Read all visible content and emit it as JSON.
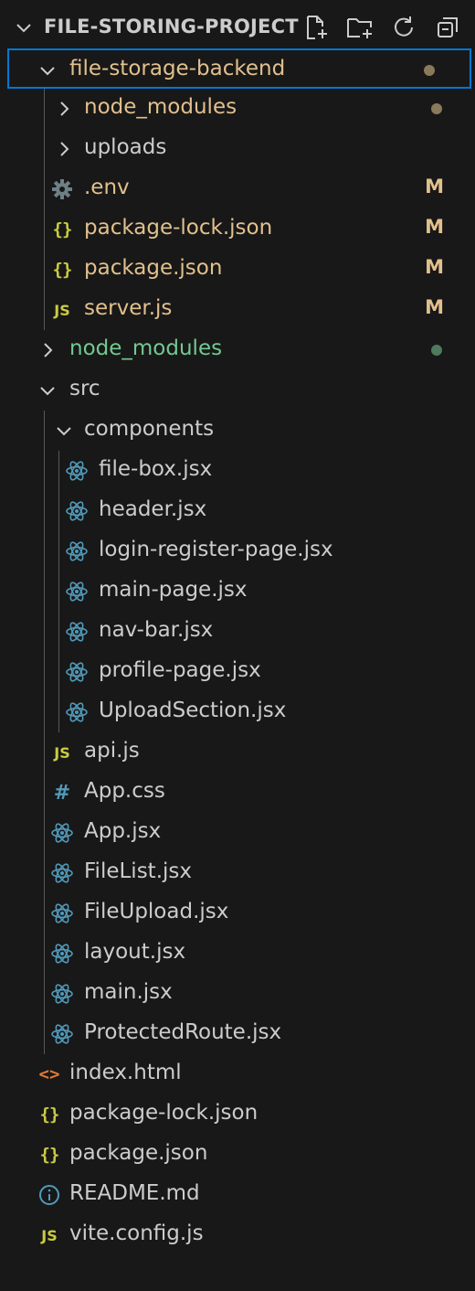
{
  "explorer": {
    "title": "FILE-STORING-PROJECT",
    "actions": [
      "new-file-icon",
      "new-folder-icon",
      "refresh-icon",
      "collapse-all-icon"
    ]
  },
  "colors": {
    "background": "#181818",
    "text": "#cccccc",
    "modified": "#e2c08d",
    "untracked": "#73c991",
    "focus_border": "#0078d4",
    "react": "#519aba",
    "js": "#cbcb41",
    "gear": "#6d8086"
  },
  "tree": [
    {
      "label": "file-storage-backend",
      "type": "folder",
      "expanded": true,
      "depth": 0,
      "status": "modified-dot",
      "focused": true
    },
    {
      "label": "node_modules",
      "type": "folder",
      "expanded": false,
      "depth": 1,
      "status": "modified-dot"
    },
    {
      "label": "uploads",
      "type": "folder",
      "expanded": false,
      "depth": 1,
      "status": ""
    },
    {
      "label": ".env",
      "type": "file",
      "icon": "gear-icon",
      "depth": 1,
      "status": "M"
    },
    {
      "label": "package-lock.json",
      "type": "file",
      "icon": "json-icon",
      "depth": 1,
      "status": "M"
    },
    {
      "label": "package.json",
      "type": "file",
      "icon": "json-icon",
      "depth": 1,
      "status": "M"
    },
    {
      "label": "server.js",
      "type": "file",
      "icon": "js-icon",
      "depth": 1,
      "status": "M"
    },
    {
      "label": "node_modules",
      "type": "folder",
      "expanded": false,
      "depth": 0,
      "status": "untracked-dot"
    },
    {
      "label": "src",
      "type": "folder",
      "expanded": true,
      "depth": 0,
      "status": ""
    },
    {
      "label": "components",
      "type": "folder",
      "expanded": true,
      "depth": 1,
      "status": ""
    },
    {
      "label": "file-box.jsx",
      "type": "file",
      "icon": "react-icon",
      "depth": 2,
      "status": ""
    },
    {
      "label": "header.jsx",
      "type": "file",
      "icon": "react-icon",
      "depth": 2,
      "status": ""
    },
    {
      "label": "login-register-page.jsx",
      "type": "file",
      "icon": "react-icon",
      "depth": 2,
      "status": ""
    },
    {
      "label": "main-page.jsx",
      "type": "file",
      "icon": "react-icon",
      "depth": 2,
      "status": ""
    },
    {
      "label": "nav-bar.jsx",
      "type": "file",
      "icon": "react-icon",
      "depth": 2,
      "status": ""
    },
    {
      "label": "profile-page.jsx",
      "type": "file",
      "icon": "react-icon",
      "depth": 2,
      "status": ""
    },
    {
      "label": "UploadSection.jsx",
      "type": "file",
      "icon": "react-icon",
      "depth": 2,
      "status": ""
    },
    {
      "label": "api.js",
      "type": "file",
      "icon": "js-icon",
      "depth": 1,
      "status": ""
    },
    {
      "label": "App.css",
      "type": "file",
      "icon": "hash-icon",
      "depth": 1,
      "status": ""
    },
    {
      "label": "App.jsx",
      "type": "file",
      "icon": "react-icon",
      "depth": 1,
      "status": ""
    },
    {
      "label": "FileList.jsx",
      "type": "file",
      "icon": "react-icon",
      "depth": 1,
      "status": ""
    },
    {
      "label": "FileUpload.jsx",
      "type": "file",
      "icon": "react-icon",
      "depth": 1,
      "status": ""
    },
    {
      "label": "layout.jsx",
      "type": "file",
      "icon": "react-icon",
      "depth": 1,
      "status": ""
    },
    {
      "label": "main.jsx",
      "type": "file",
      "icon": "react-icon",
      "depth": 1,
      "status": ""
    },
    {
      "label": "ProtectedRoute.jsx",
      "type": "file",
      "icon": "react-icon",
      "depth": 1,
      "status": ""
    },
    {
      "label": "index.html",
      "type": "file",
      "icon": "html-icon",
      "depth": 0,
      "status": ""
    },
    {
      "label": "package-lock.json",
      "type": "file",
      "icon": "json-icon",
      "depth": 0,
      "status": ""
    },
    {
      "label": "package.json",
      "type": "file",
      "icon": "json-icon",
      "depth": 0,
      "status": ""
    },
    {
      "label": "README.md",
      "type": "file",
      "icon": "info-icon",
      "depth": 0,
      "status": ""
    },
    {
      "label": "vite.config.js",
      "type": "file",
      "icon": "js-icon",
      "depth": 0,
      "status": ""
    }
  ]
}
